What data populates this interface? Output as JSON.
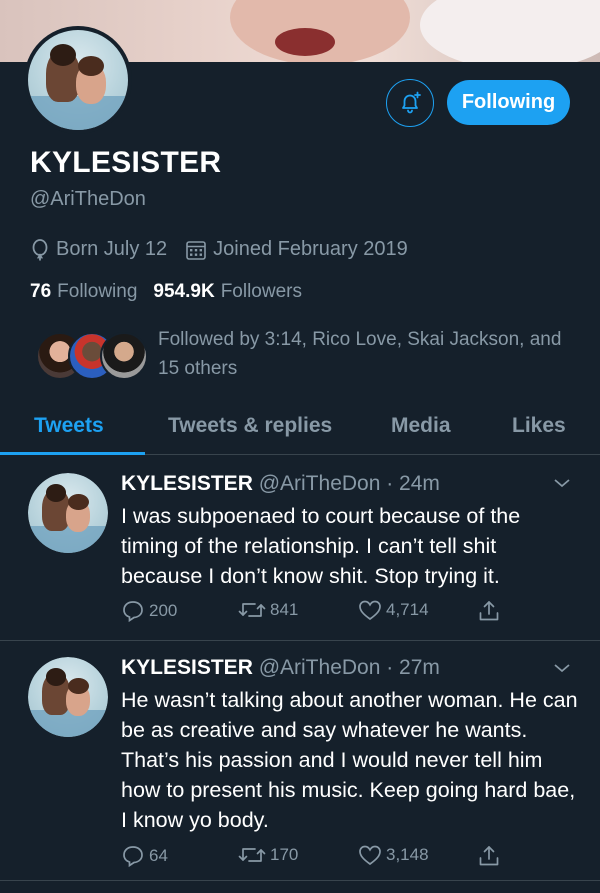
{
  "profile": {
    "display_name": "KYLESISTER",
    "handle": "@AriTheDon",
    "birthday": "Born July 12",
    "joined": "Joined February 2019",
    "following_count": "76",
    "following_label": "Following",
    "followers_count": "954.9K",
    "followers_label": "Followers",
    "followed_by": "Followed by 3:14, Rico Love, Skai Jackson, and 15 others",
    "follow_button_label": "Following"
  },
  "tabs": [
    {
      "label": "Tweets",
      "active": true
    },
    {
      "label": "Tweets & replies",
      "active": false
    },
    {
      "label": "Media",
      "active": false
    },
    {
      "label": "Likes",
      "active": false
    }
  ],
  "tweets": [
    {
      "name": "KYLESISTER",
      "handle_time": "@AriTheDon · 24m",
      "text": "I was subpoenaed to court because of the timing of the relationship. I can’t tell shit because I don’t know shit. Stop trying it.",
      "replies": "200",
      "retweets": "841",
      "likes": "4,714"
    },
    {
      "name": "KYLESISTER",
      "handle_time": "@AriTheDon · 27m",
      "text": "He wasn’t talking about another woman. He can be as creative and say whatever he wants. That’s his passion and I would never tell him how to present his music. Keep going hard bae, I know yo body.",
      "replies": "64",
      "retweets": "170",
      "likes": "3,148"
    }
  ],
  "colors": {
    "background": "#15202b",
    "accent": "#1da1f2",
    "secondary_text": "#8899a6",
    "divider": "#38444d"
  },
  "icons": [
    "bell-plus-icon",
    "birthday-balloon-icon",
    "calendar-icon",
    "reply-icon",
    "retweet-icon",
    "like-icon",
    "share-icon",
    "chevron-down-icon"
  ]
}
